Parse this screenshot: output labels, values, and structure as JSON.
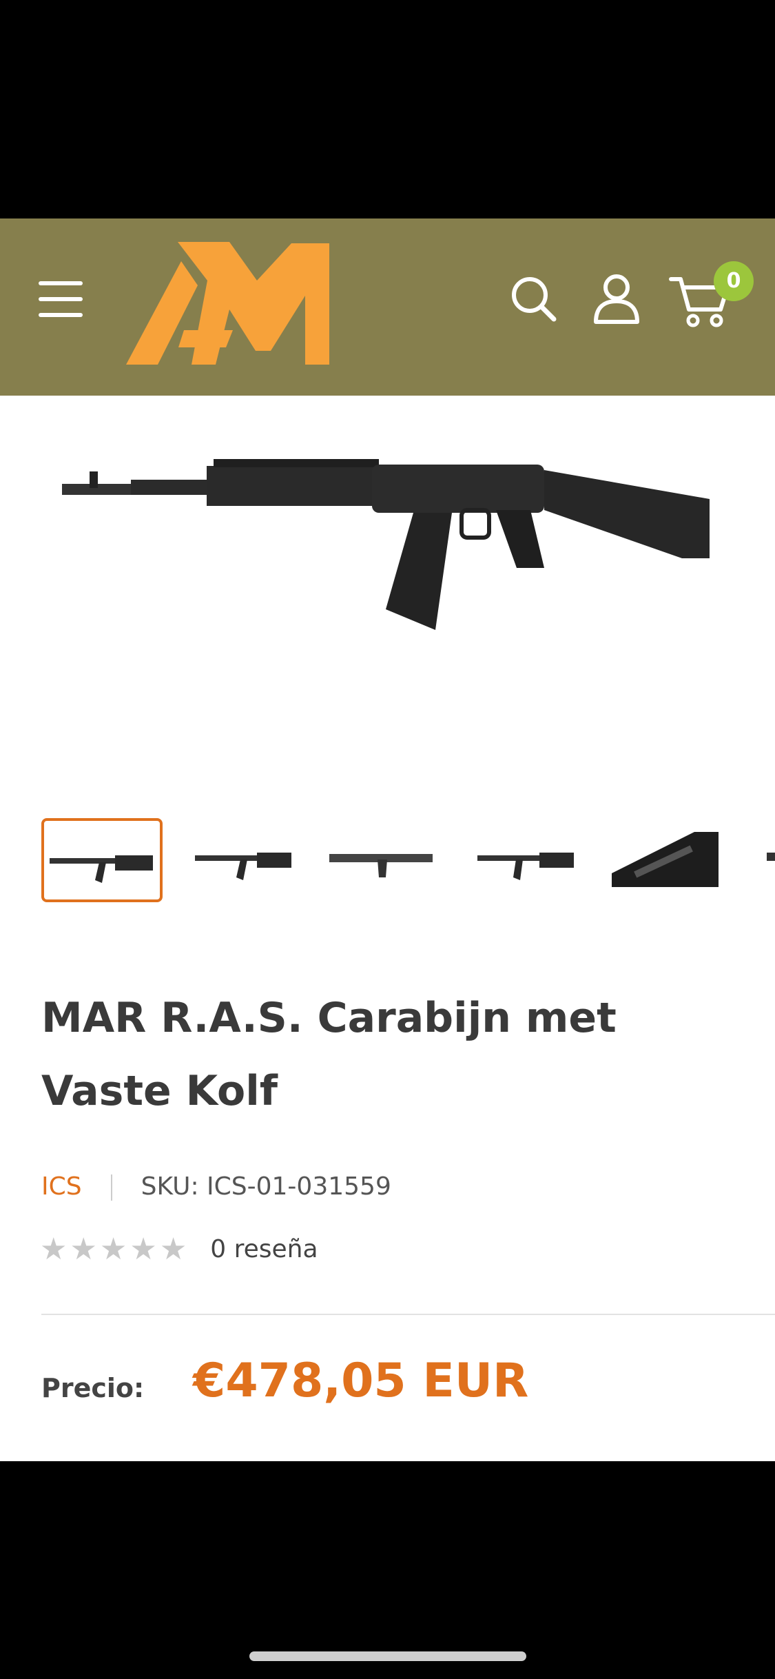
{
  "header": {
    "bg_color": "#867f4d",
    "logo_text": "AM",
    "logo_color": "#f7a23a",
    "icons": [
      "hamburger-menu-icon",
      "search-icon",
      "account-icon",
      "cart-icon"
    ],
    "cart_count": "0",
    "badge_color": "#9cc63c"
  },
  "gallery": {
    "thumbnail_count": 6,
    "active_index": 0,
    "active_color": "#e0711d"
  },
  "product": {
    "title": "MAR R.A.S. Carabijn met Vaste Kolf",
    "brand": "ICS",
    "sku": "SKU: ICS-01-031559",
    "rating_stars": 0,
    "rating_max": 5,
    "review_count": "0 reseña",
    "price_label": "Precio:",
    "price": "€478,05 EUR",
    "accent_color": "#e0711d"
  }
}
